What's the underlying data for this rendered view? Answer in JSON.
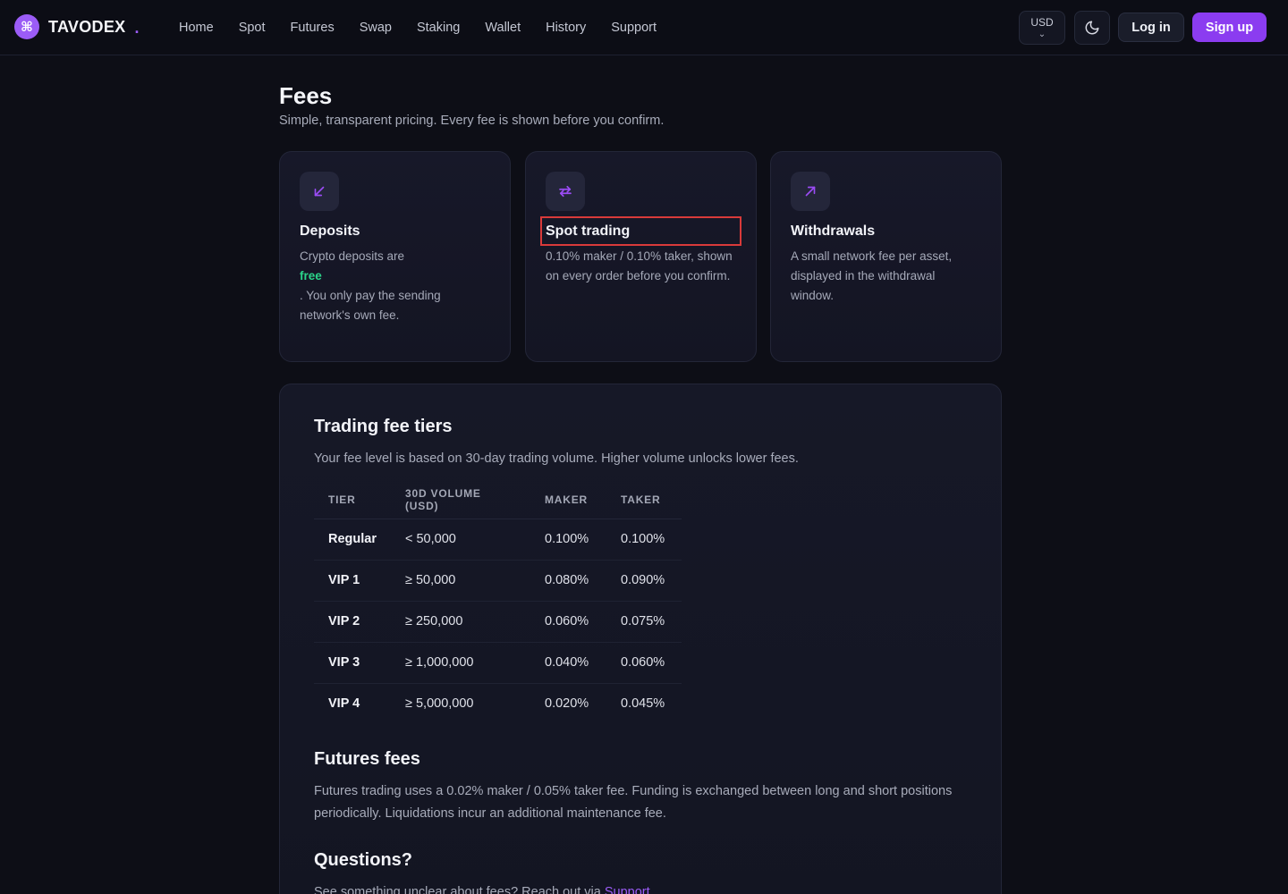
{
  "header": {
    "brand": "TAVODEX",
    "brand_suffix": ".",
    "nav": [
      "Home",
      "Spot",
      "Futures",
      "Swap",
      "Staking",
      "Wallet",
      "History",
      "Support"
    ],
    "currency": "USD",
    "login_label": "Log in",
    "signup_label": "Sign up"
  },
  "page": {
    "title": "Fees",
    "subtitle": "Simple, transparent pricing. Every fee is shown before you confirm."
  },
  "cards": [
    {
      "title": "Deposits",
      "body_before": "Crypto deposits are",
      "body_highlight": "free",
      "body_after": ". You only pay the sending network's own fee.",
      "icon": "arrow-down-left-icon"
    },
    {
      "title": "Spot trading",
      "body": "0.10% maker / 0.10% taker, shown on every order before you confirm.",
      "icon": "swap-arrows-icon"
    },
    {
      "title": "Withdrawals",
      "body": "A small network fee per asset, displayed in the withdrawal window.",
      "icon": "arrow-up-right-icon"
    }
  ],
  "tiers": {
    "title": "Trading fee tiers",
    "description": "Your fee level is based on 30-day trading volume. Higher volume unlocks lower fees.",
    "columns": [
      "TIER",
      "30D VOLUME (USD)",
      "MAKER",
      "TAKER"
    ],
    "rows": [
      [
        "Regular",
        "< 50,000",
        "0.100%",
        "0.100%"
      ],
      [
        "VIP 1",
        "≥ 50,000",
        "0.080%",
        "0.090%"
      ],
      [
        "VIP 2",
        "≥ 250,000",
        "0.060%",
        "0.075%"
      ],
      [
        "VIP 3",
        "≥ 1,000,000",
        "0.040%",
        "0.060%"
      ],
      [
        "VIP 4",
        "≥ 5,000,000",
        "0.020%",
        "0.045%"
      ]
    ]
  },
  "futures": {
    "title": "Futures fees",
    "description": "Futures trading uses a 0.02% maker / 0.05% taker fee. Funding is exchanged between long and short positions periodically. Liquidations incur an additional maintenance fee."
  },
  "questions": {
    "title": "Questions?",
    "text": "See something unclear about fees? Reach out via ",
    "link": "Support"
  },
  "colors": {
    "accent": "#8b3cf0",
    "success": "#2bd48a",
    "highlight_border": "#d93a3a"
  }
}
